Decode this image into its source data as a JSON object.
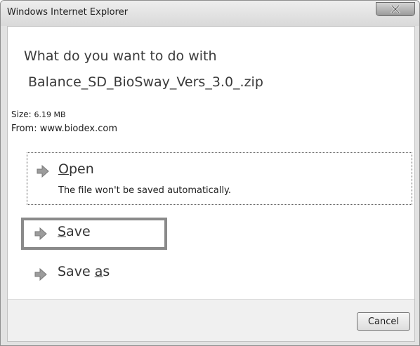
{
  "window": {
    "title": "Windows Internet Explorer",
    "close_label": "X"
  },
  "prompt": {
    "line1": "What do you want to do with",
    "line2": "Balance_SD_BioSway_Vers_3.0_.zip"
  },
  "file_info": {
    "size_label": "Size:",
    "size_value": "6.19 MB",
    "from_label": "From:",
    "from_value": "www.biodex.com"
  },
  "options": {
    "open": {
      "underlined": "O",
      "rest": "pen",
      "description": "The file won't be saved automatically.",
      "icon": "arrow-right-icon"
    },
    "save": {
      "underlined": "S",
      "rest": "ave",
      "icon": "arrow-right-icon"
    },
    "save_as": {
      "before": "Save ",
      "underlined": "a",
      "rest": "s",
      "icon": "arrow-right-icon"
    }
  },
  "footer": {
    "cancel_label": "Cancel"
  },
  "colors": {
    "highlight_border": "#8a8a8a",
    "arrow_fill": "#9c9c9c"
  }
}
